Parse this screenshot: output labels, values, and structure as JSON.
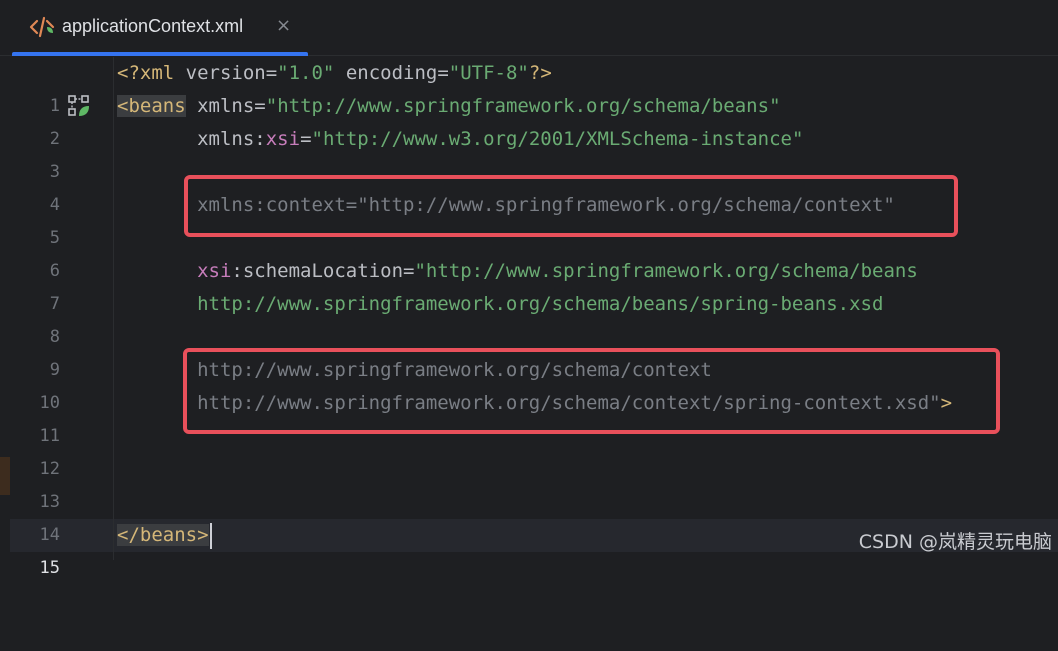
{
  "tab": {
    "title": "applicationContext.xml",
    "close": "×"
  },
  "lines": [
    {
      "num": "1"
    },
    {
      "num": "2"
    },
    {
      "num": "3"
    },
    {
      "num": "4"
    },
    {
      "num": "5"
    },
    {
      "num": "6"
    },
    {
      "num": "7"
    },
    {
      "num": "8"
    },
    {
      "num": "9"
    },
    {
      "num": "10"
    },
    {
      "num": "11"
    },
    {
      "num": "12"
    },
    {
      "num": "13"
    },
    {
      "num": "14"
    },
    {
      "num": "15"
    }
  ],
  "code": {
    "l1": {
      "open": "<?xml ",
      "a1": "version",
      "eq1": "=",
      "v1": "\"1.0\"",
      "sp": " ",
      "a2": "encoding",
      "eq2": "=",
      "v2": "\"UTF-8\"",
      "close": "?>"
    },
    "l2": {
      "tag": "<beans",
      "sp": " ",
      "attr": "xmlns",
      "eq": "=",
      "val": "\"http://www.springframework.org/schema/beans\""
    },
    "l3": {
      "indent": "       ",
      "attr": "xmlns",
      "colon": ":",
      "ns": "xsi",
      "eq": "=",
      "val": "\"http://www.w3.org/2001/XMLSchema-instance\""
    },
    "l5": {
      "indent": "       ",
      "text": "xmlns:context=\"http://www.springframework.org/schema/context\""
    },
    "l7": {
      "indent": "       ",
      "ns": "xsi",
      "colon": ":",
      "attr": "schemaLocation",
      "eq": "=",
      "val": "\"http://www.springframework.org/schema/beans"
    },
    "l8": {
      "indent": "       ",
      "val": "http://www.springframework.org/schema/beans/spring-beans.xsd"
    },
    "l10": {
      "indent": "       ",
      "text": "http://www.springframework.org/schema/context"
    },
    "l11": {
      "indent": "       ",
      "text": "http://www.springframework.org/schema/context/spring-context.xsd\"",
      "close": ">"
    },
    "l15": {
      "tag": "</beans>"
    }
  },
  "watermark": "CSDN @岚精灵玩电脑",
  "colors": {
    "accent": "#3574f0",
    "highlight_box": "#e8505b",
    "tag": "#d5b778",
    "string": "#6aab73",
    "namespace": "#c77dbb"
  },
  "icons": {
    "tab": "xml-file-icon",
    "gutter": "spring-bean-icon"
  }
}
